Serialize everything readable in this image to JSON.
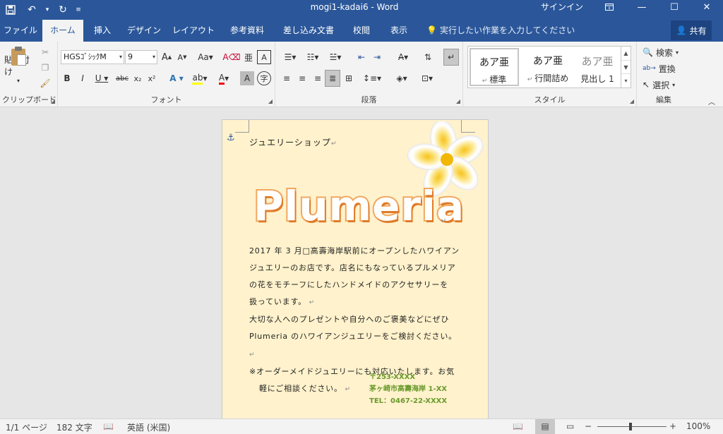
{
  "window": {
    "title": "mogi1-kadai6  -  Word",
    "signin": "サインイン"
  },
  "tabs": [
    {
      "label": "ファイル"
    },
    {
      "label": "ホーム"
    },
    {
      "label": "挿入"
    },
    {
      "label": "デザイン"
    },
    {
      "label": "レイアウト"
    },
    {
      "label": "参考資料"
    },
    {
      "label": "差し込み文書"
    },
    {
      "label": "校閲"
    },
    {
      "label": "表示"
    }
  ],
  "tellme": "実行したい作業を入力してください",
  "share": "共有",
  "ribbon": {
    "clipboard": {
      "paste": "貼り付け",
      "label": "クリップボード"
    },
    "font": {
      "name": "HGSｺﾞｼｯｸM",
      "size": "9",
      "label": "フォント"
    },
    "paragraph": {
      "label": "段落"
    },
    "styles": {
      "label": "スタイル",
      "items": [
        {
          "preview": "あア亜",
          "name": "標準"
        },
        {
          "preview": "あア亜",
          "name": "行間詰め"
        },
        {
          "preview": "あア亜",
          "name": "見出し 1"
        }
      ]
    },
    "editing": {
      "find": "検索",
      "replace": "置換",
      "select": "選択",
      "label": "編集"
    }
  },
  "document": {
    "shop_line": "ジュエリーショップ",
    "logo": "Plumeria",
    "paragraphs": [
      "2017 年 3 月□高壽海岸駅前にオープンしたハワイアン",
      "ジュエリーのお店です。店名にもなっているプルメリア",
      "の花をモチーフにしたハンドメイドのアクセサリーを",
      "扱っています。",
      "大切な人へのプレゼントや自分へのご褒美などにぜひ",
      "Plumeria のハワイアンジュエリーをご検討ください。",
      "※オーダーメイドジュエリーにも対応いたします。お気",
      "軽にご相談ください。"
    ],
    "address": [
      "〒253-XXXX",
      "茅ヶ崎市高壽海岸 1-XX",
      "TEL：0467-22-XXXX"
    ]
  },
  "status": {
    "page": "1/1 ページ",
    "words": "182 文字",
    "language": "英語 (米国)",
    "zoom": "100%"
  }
}
